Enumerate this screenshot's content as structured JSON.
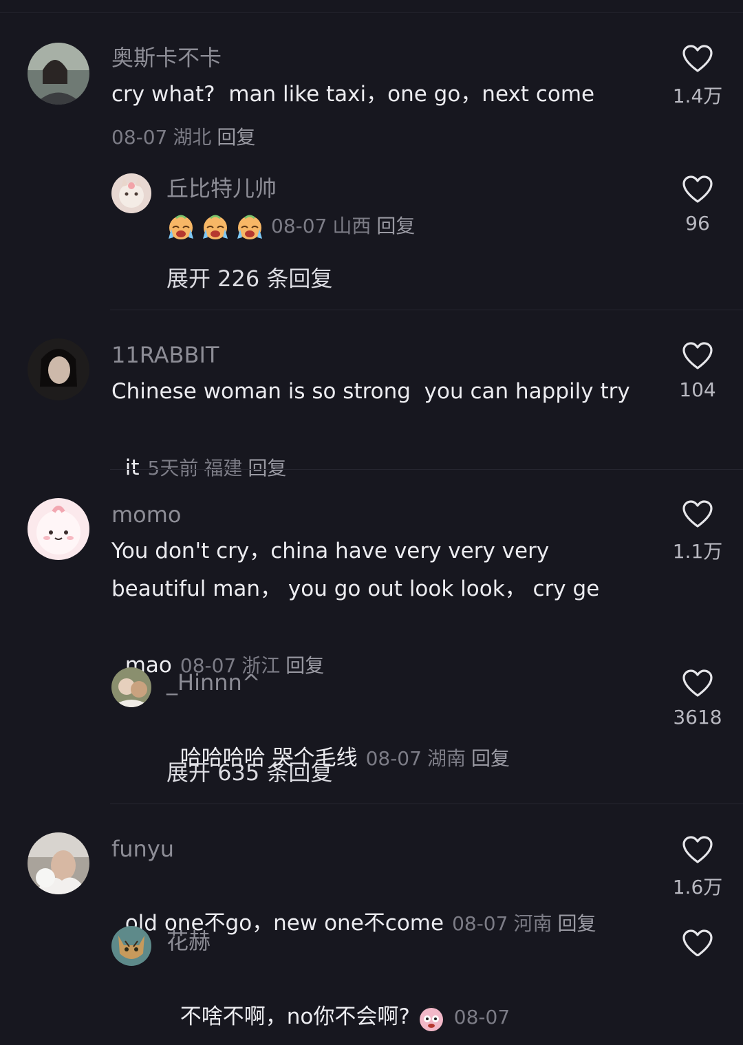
{
  "comments": [
    {
      "user": "奥斯卡不卡",
      "text": "cry what?  man like taxi，one go，next come",
      "date": "08-07",
      "region": "湖北",
      "reply": "回复",
      "likes": "1.4万",
      "subreply": {
        "user": "丘比特儿帅",
        "date": "08-07",
        "region": "山西",
        "reply": "回复",
        "likes": "96",
        "emoji": "crying-face-emoji x3"
      },
      "expand": "展开 226 条回复"
    },
    {
      "user": "11RABBIT",
      "text_line1": "Chinese woman is so strong  you can happily try",
      "text_line2": "it",
      "date": "5天前",
      "region": "福建",
      "reply": "回复",
      "likes": "104"
    },
    {
      "user": "momo",
      "text_line1": "You don't cry，china have very very very",
      "text_line2": "beautiful man， you go out look look， cry ge",
      "text_line3": "mao",
      "date": "08-07",
      "region": "浙江",
      "reply": "回复",
      "likes": "1.1万",
      "subreply": {
        "user": "_Hinnn^",
        "text": "哈哈哈哈 哭个毛线",
        "date": "08-07",
        "region": "湖南",
        "reply": "回复",
        "likes": "3618"
      },
      "expand": "展开 635 条回复"
    },
    {
      "user": "funyu",
      "text": "old one不go，new one不come",
      "date": "08-07",
      "region": "河南",
      "reply": "回复",
      "likes": "1.6万",
      "subreply": {
        "user": "花赫",
        "text": "不啥不啊，no你不会啊?",
        "date": "08-07"
      }
    }
  ],
  "colors": {
    "background": "#17171f",
    "username": "#8d8d96",
    "text": "#ececf0",
    "meta": "#7c7c86"
  }
}
